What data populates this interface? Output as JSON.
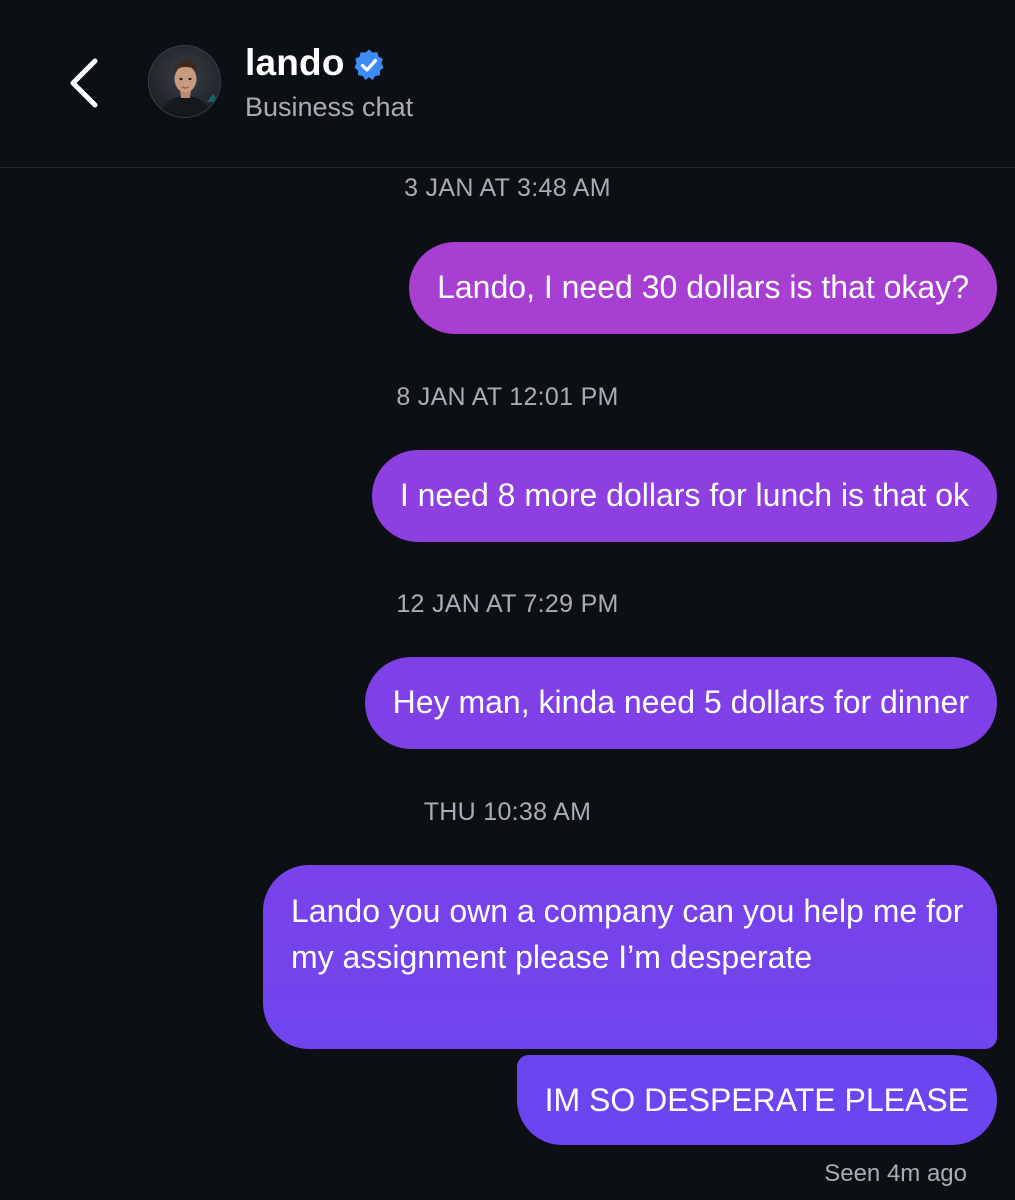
{
  "header": {
    "back_icon": "chevron-left-icon",
    "contact_name": "lando",
    "verified_icon": "verified-badge-icon",
    "subtitle": "Business chat"
  },
  "conversation": [
    {
      "timestamp": "3 JAN AT 3:48 AM",
      "message": "Lando, I need 30 dollars is that okay?"
    },
    {
      "timestamp": "8 JAN AT 12:01 PM",
      "message": "I need 8 more dollars for lunch is that ok"
    },
    {
      "timestamp": "12 JAN AT 7:29 PM",
      "message": "Hey man, kinda need 5 dollars for dinner"
    },
    {
      "timestamp": "THU 10:38 AM",
      "message": "Lando you own a company can you help me for my assignment please I’m desperate"
    }
  ],
  "last_message": "IM SO DESPERATE PLEASE",
  "status": "Seen 4m ago",
  "colors": {
    "background": "#0c0f14",
    "bubble_top": "#a83fd3",
    "bubble_bottom": "#6d45f0",
    "verified": "#3d8bf5",
    "secondary_text": "#a8adb5"
  }
}
